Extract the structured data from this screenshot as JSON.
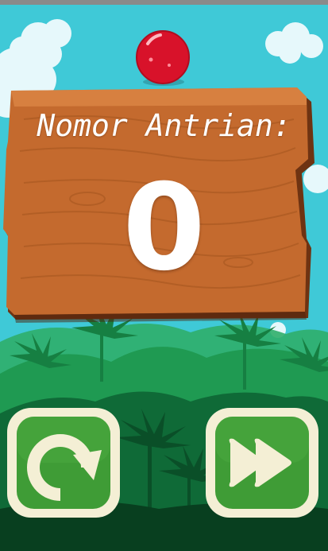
{
  "board": {
    "label": "Nomor Antrian:",
    "queue_number": "0"
  },
  "buttons": {
    "replay": {
      "icon": "replay-icon"
    },
    "next": {
      "icon": "fast-forward-icon"
    }
  },
  "colors": {
    "sky": "#3ec9d6",
    "wood": "#b8612a",
    "ball": "#e0142a",
    "button_green": "#3e9a35",
    "button_border": "#f3efd6"
  }
}
